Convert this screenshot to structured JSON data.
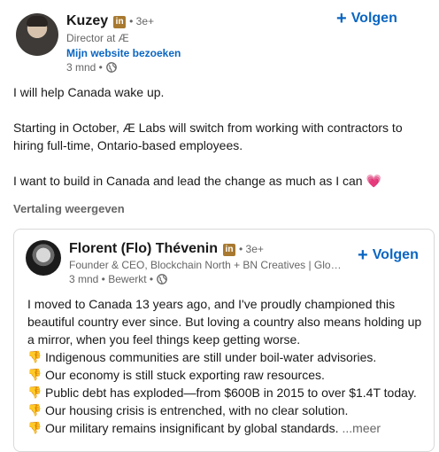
{
  "author": {
    "name": "Kuzey",
    "badge": "in",
    "degree": "• 3e+",
    "headline": "Director at Æ",
    "website_link": "Mijn website bezoeken",
    "timestamp": "3 mnd •",
    "follow_label": "Volgen"
  },
  "post": {
    "paragraphs": [
      "I will help Canada wake up.",
      "Starting in October, Æ Labs will switch from working with contractors to",
      "hiring full-time, Ontario-based employees.",
      "I want to build in Canada and lead the change as much as I can",
      "💗"
    ],
    "translate_label": "Vertaling weergeven"
  },
  "quoted": {
    "name": "Florent (Flo) Thévenin",
    "badge": "in",
    "degree": "• 3e+",
    "headline": "Founder & CEO, Blockchain North + BN Creatives | Global...",
    "timestamp": "3 mnd • Bewerkt •",
    "follow_label": "Volgen",
    "lines": [
      "I moved to Canada 13 years ago, and I've proudly championed this",
      "beautiful country ever since. But loving a country also means holding up",
      "a mirror, when you feel things keep getting worse."
    ],
    "bullets": [
      "Indigenous communities are still under boil-water advisories.",
      "Our economy is still stuck exporting raw resources.",
      "Public debt has exploded—from $600B in 2015 to over $1.4T today.",
      "Our housing crisis is entrenched, with no clear solution.",
      "Our military remains insignificant by global standards."
    ],
    "bullet_icon": "thumbs-down-icon",
    "more_label": "...meer"
  },
  "colors": {
    "link_blue": "#0a66c2",
    "badge_gold": "#a8792f",
    "heart_pink": "#e8487a",
    "thumb_yellow": "#c9911f"
  }
}
